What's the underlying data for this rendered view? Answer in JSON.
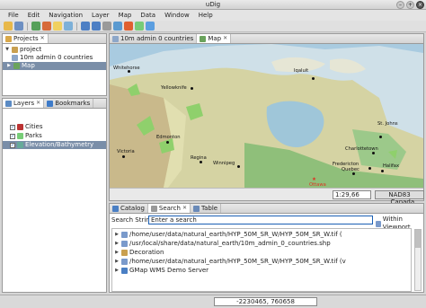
{
  "window": {
    "title": "uDig"
  },
  "menu": [
    "File",
    "Edit",
    "Navigation",
    "Layer",
    "Map",
    "Data",
    "Window",
    "Help"
  ],
  "projects_panel": {
    "tabs": [
      {
        "label": "Projects"
      }
    ],
    "tree": [
      {
        "label": "project"
      },
      {
        "label": "10m admin 0 countries"
      },
      {
        "label": "Map"
      }
    ]
  },
  "layers_panel": {
    "tabs": [
      {
        "label": "Layers"
      },
      {
        "label": "Bookmarks"
      }
    ],
    "items": [
      {
        "label": "Cities"
      },
      {
        "label": "Parks"
      },
      {
        "label": "Elevation/Bathymetry"
      }
    ]
  },
  "editor": {
    "tabs": [
      {
        "label": "10m admin 0 countries"
      },
      {
        "label": "Map"
      }
    ],
    "scale": "1:29,66",
    "crs": "NAD83 ...Canada",
    "cities": [
      "Whitehorse",
      "Iqaluit",
      "Yellowknife",
      "Edmonton",
      "Victoria",
      "Regina",
      "Winnipeg",
      "St. Johns",
      "Charlottetown",
      "Fredericton",
      "Quebec",
      "Halifax",
      "Ottawa"
    ]
  },
  "bottom_panel": {
    "tabs": [
      {
        "label": "Catalog"
      },
      {
        "label": "Search"
      },
      {
        "label": "Table"
      }
    ],
    "search_label": "Search String:",
    "search_value": "Enter a search",
    "within_viewport": "Within Viewport",
    "results": [
      "/home/user/data/natural_earth/HYP_50M_SR_W/HYP_50M_SR_W.tif (",
      "/usr/local/share/data/natural_earth/10m_admin_0_countries.shp",
      "Decoration",
      "/home/user/data/natural_earth/HYP_50M_SR_W/HYP_50M_SR_W.tif (v",
      "GMap WMS Demo Server"
    ]
  },
  "status": {
    "coordinates": "-2230465, 760658"
  },
  "colors": {
    "selection": "#7a8ea8",
    "accent": "#1a5fb4",
    "ocean": "#a9cbe0",
    "land": "#d7d39a"
  }
}
